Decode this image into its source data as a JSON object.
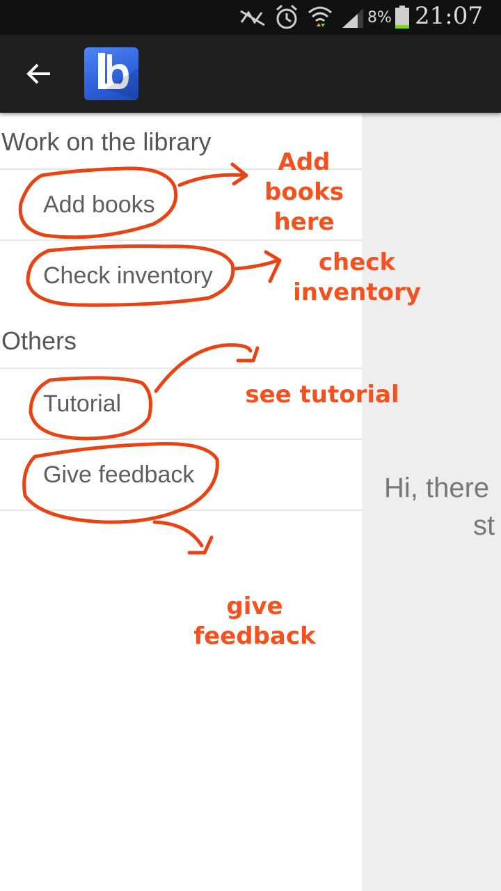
{
  "status_bar": {
    "icons": [
      "nfc-icon",
      "alarm-icon",
      "wifi-icon",
      "signal-icon",
      "battery-icon"
    ],
    "battery_percent": "8%",
    "time": "21:07"
  },
  "action_bar": {
    "back_icon": "arrow-back-icon",
    "logo_text": "Lb"
  },
  "drawer": {
    "sections": [
      {
        "header": "Work on the library",
        "items": [
          {
            "label": "Add books"
          },
          {
            "label": "Check inventory"
          }
        ]
      },
      {
        "header": "Others",
        "items": [
          {
            "label": "Tutorial"
          },
          {
            "label": "Give feedback"
          }
        ]
      }
    ]
  },
  "content": {
    "greeting_line1": "Hi, there",
    "greeting_line2": "st"
  },
  "annotations": {
    "add_books": [
      "Add",
      "books",
      "here"
    ],
    "check_inventory": [
      "check",
      "inventory"
    ],
    "tutorial": "see tutorial",
    "feedback": [
      "give",
      "feedback"
    ],
    "color": "#f4511e"
  },
  "colors": {
    "status_bar": "#111111",
    "action_bar": "#1f1f1f",
    "logo": "#2f62dc",
    "content_bg": "#eeeeee"
  }
}
